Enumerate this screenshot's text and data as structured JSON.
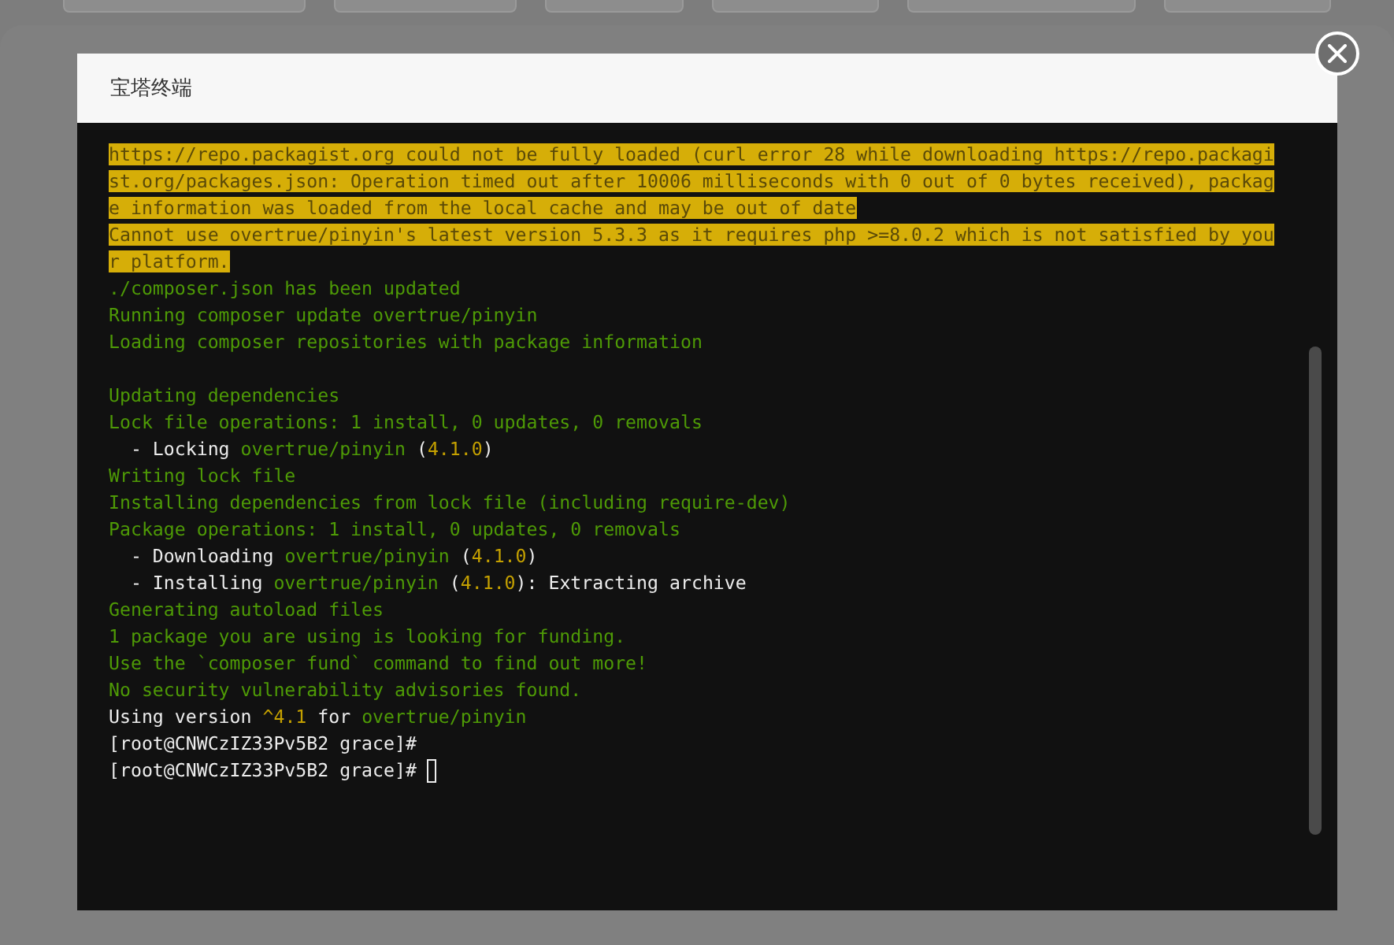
{
  "dialog": {
    "title": "宝塔终端",
    "terminal": {
      "lines": [
        {
          "kind": "text",
          "segments": [
            {
              "text": "https://repo.packagist.org could not be fully loaded (curl error 28 while downloading https://repo.packagi",
              "kind": "warning"
            }
          ]
        },
        {
          "kind": "text",
          "segments": [
            {
              "text": "st.org/packages.json: Operation timed out after 10006 milliseconds with 0 out of 0 bytes received), packag",
              "kind": "warning"
            }
          ]
        },
        {
          "kind": "text",
          "segments": [
            {
              "text": "e information was loaded from the local cache and may be out of date",
              "kind": "warning"
            }
          ]
        },
        {
          "kind": "text",
          "segments": [
            {
              "text": "Cannot use overtrue/pinyin's latest version 5.3.3 as it requires php >=8.0.2 which is not satisfied by you",
              "kind": "warning"
            }
          ]
        },
        {
          "kind": "text",
          "segments": [
            {
              "text": "r platform.",
              "kind": "warning"
            }
          ]
        },
        {
          "kind": "text",
          "segments": [
            {
              "text": "./composer.json has been updated",
              "kind": "info"
            }
          ]
        },
        {
          "kind": "text",
          "segments": [
            {
              "text": "Running composer update overtrue/pinyin",
              "kind": "info"
            }
          ]
        },
        {
          "kind": "text",
          "segments": [
            {
              "text": "Loading composer repositories with package information",
              "kind": "info"
            }
          ]
        },
        {
          "kind": "blank"
        },
        {
          "kind": "text",
          "segments": [
            {
              "text": "Updating dependencies",
              "kind": "info"
            }
          ]
        },
        {
          "kind": "text",
          "segments": [
            {
              "text": "Lock file operations: 1 install, 0 updates, 0 removals",
              "kind": "info"
            }
          ]
        },
        {
          "kind": "text",
          "segments": [
            {
              "text": "  - Locking ",
              "kind": "plain"
            },
            {
              "text": "overtrue/pinyin",
              "kind": "info"
            },
            {
              "text": " (",
              "kind": "plain"
            },
            {
              "text": "4.1.0",
              "kind": "version"
            },
            {
              "text": ")",
              "kind": "plain"
            }
          ]
        },
        {
          "kind": "text",
          "segments": [
            {
              "text": "Writing lock file",
              "kind": "info"
            }
          ]
        },
        {
          "kind": "text",
          "segments": [
            {
              "text": "Installing dependencies from lock file (including require-dev)",
              "kind": "info"
            }
          ]
        },
        {
          "kind": "text",
          "segments": [
            {
              "text": "Package operations: 1 install, 0 updates, 0 removals",
              "kind": "info"
            }
          ]
        },
        {
          "kind": "text",
          "segments": [
            {
              "text": "  - Downloading ",
              "kind": "plain"
            },
            {
              "text": "overtrue/pinyin",
              "kind": "info"
            },
            {
              "text": " (",
              "kind": "plain"
            },
            {
              "text": "4.1.0",
              "kind": "version"
            },
            {
              "text": ")",
              "kind": "plain"
            }
          ]
        },
        {
          "kind": "text",
          "segments": [
            {
              "text": "  - Installing ",
              "kind": "plain"
            },
            {
              "text": "overtrue/pinyin",
              "kind": "info"
            },
            {
              "text": " (",
              "kind": "plain"
            },
            {
              "text": "4.1.0",
              "kind": "version"
            },
            {
              "text": "): Extracting archive",
              "kind": "plain"
            }
          ]
        },
        {
          "kind": "text",
          "segments": [
            {
              "text": "Generating autoload files",
              "kind": "info"
            }
          ]
        },
        {
          "kind": "text",
          "segments": [
            {
              "text": "1 package you are using is looking for funding.",
              "kind": "info"
            }
          ]
        },
        {
          "kind": "text",
          "segments": [
            {
              "text": "Use the `composer fund` command to find out more!",
              "kind": "info"
            }
          ]
        },
        {
          "kind": "text",
          "segments": [
            {
              "text": "No security vulnerability advisories found.",
              "kind": "info"
            }
          ]
        },
        {
          "kind": "text",
          "segments": [
            {
              "text": "Using version ",
              "kind": "plain"
            },
            {
              "text": "^4.1",
              "kind": "version"
            },
            {
              "text": " for ",
              "kind": "plain"
            },
            {
              "text": "overtrue/pinyin",
              "kind": "info"
            }
          ]
        },
        {
          "kind": "text",
          "segments": [
            {
              "text": "[root@CNWCzIZ33Pv5B2 grace]#",
              "kind": "plain"
            }
          ]
        },
        {
          "kind": "input",
          "segments": [
            {
              "text": "[root@CNWCzIZ33Pv5B2 grace]# ",
              "kind": "plain"
            }
          ]
        }
      ]
    }
  }
}
